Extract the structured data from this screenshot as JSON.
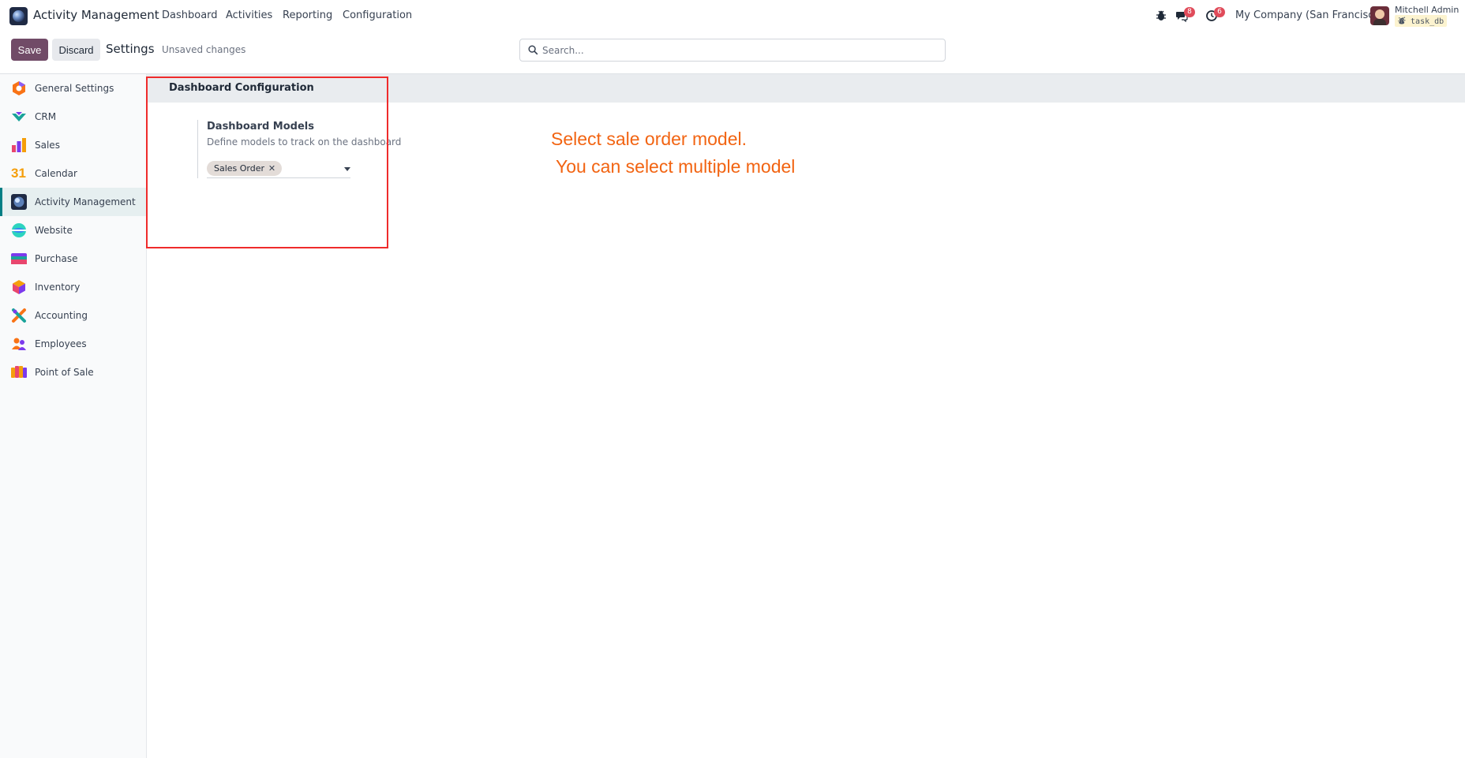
{
  "topbar": {
    "app_name": "Activity Management",
    "menu": [
      "Dashboard",
      "Activities",
      "Reporting",
      "Configuration"
    ],
    "messages_count": "8",
    "activities_count": "6",
    "company": "My Company (San Francisco)",
    "user_name": "Mitchell Admin",
    "user_db": "task_db",
    "icons": {
      "app": "activity-management-app-icon",
      "debug": "bug-icon",
      "messages": "chat-icon",
      "activities": "clock-icon",
      "user": "avatar"
    }
  },
  "control": {
    "save_label": "Save",
    "discard_label": "Discard",
    "title": "Settings",
    "status": "Unsaved changes",
    "search_placeholder": "Search..."
  },
  "sidebar": {
    "items": [
      {
        "label": "General Settings",
        "icon": "general-settings-icon"
      },
      {
        "label": "CRM",
        "icon": "crm-icon"
      },
      {
        "label": "Sales",
        "icon": "sales-icon"
      },
      {
        "label": "Calendar",
        "icon": "calendar-icon",
        "icon_text": "31"
      },
      {
        "label": "Activity Management",
        "icon": "activity-management-icon",
        "active": true
      },
      {
        "label": "Website",
        "icon": "website-icon"
      },
      {
        "label": "Purchase",
        "icon": "purchase-icon"
      },
      {
        "label": "Inventory",
        "icon": "inventory-icon"
      },
      {
        "label": "Accounting",
        "icon": "accounting-icon"
      },
      {
        "label": "Employees",
        "icon": "employees-icon"
      },
      {
        "label": "Point of Sale",
        "icon": "point-of-sale-icon"
      }
    ]
  },
  "section": {
    "title": "Dashboard Configuration",
    "setting_title": "Dashboard Models",
    "setting_desc": "Define models to track on the dashboard",
    "tags": [
      "Sales Order"
    ],
    "tag_remove": "✕"
  },
  "annotation": {
    "line1": "Select sale order model.",
    "line2": " You can select multiple model",
    "color": "#f26412",
    "box_color": "#ef2b2b"
  },
  "colors": {
    "brand": "#714b67",
    "active_nav": "#017e84",
    "badge": "#e04b5a"
  }
}
